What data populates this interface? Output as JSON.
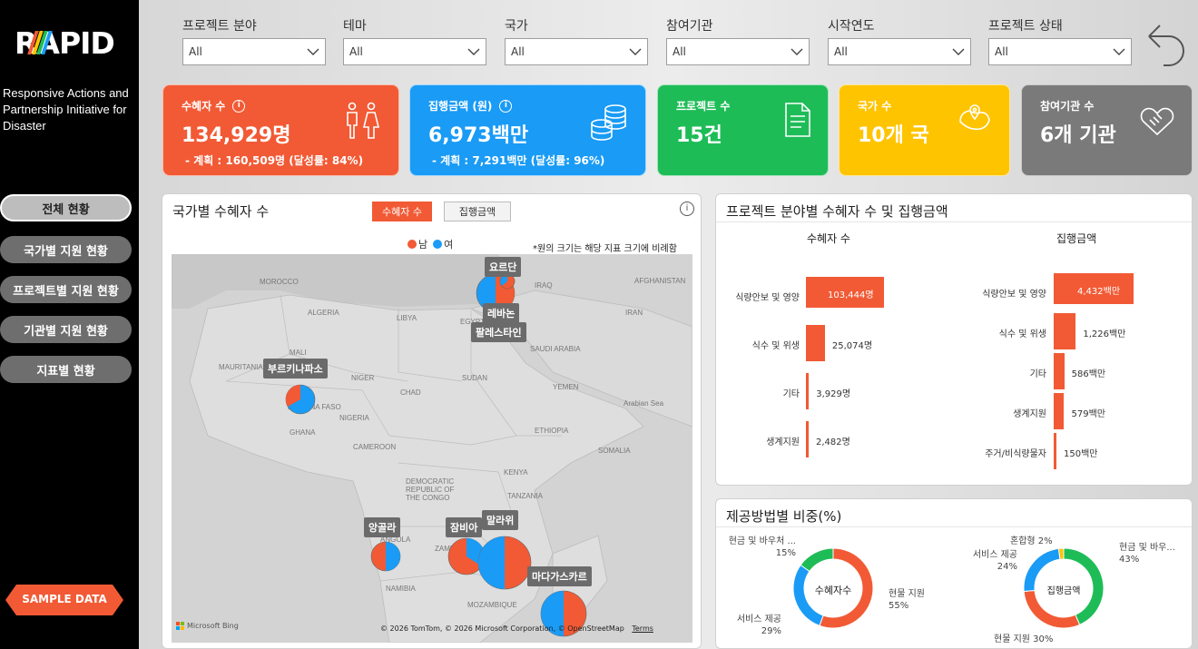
{
  "brand": {
    "logo_text": "RAPID",
    "tagline": "Responsive Actions and Partnership Initiative for Disaster",
    "sample_label": "SAMPLE DATA"
  },
  "nav": [
    {
      "label": "전체 현황",
      "active": true
    },
    {
      "label": "국가별 지원 현황",
      "active": false
    },
    {
      "label": "프로젝트별 지원 현황",
      "active": false
    },
    {
      "label": "기관별 지원 현황",
      "active": false
    },
    {
      "label": "지표별 현황",
      "active": false
    }
  ],
  "filters": [
    {
      "label": "프로젝트 분야",
      "value": "All"
    },
    {
      "label": "테마",
      "value": "All"
    },
    {
      "label": "국가",
      "value": "All"
    },
    {
      "label": "참여기관",
      "value": "All"
    },
    {
      "label": "시작연도",
      "value": "All"
    },
    {
      "label": "프로젝트 상태",
      "value": "All"
    }
  ],
  "kpis": [
    {
      "label": "수혜자 수",
      "value": "134,929명",
      "sub": "- 계획 : 160,509명 (달성률: 84%)",
      "color": "#f15a35",
      "icon": "people-icon"
    },
    {
      "label": "집행금액 (원)",
      "value": "6,973백만",
      "sub": "- 계획 : 7,291백만 (달성률: 96%)",
      "color": "#1a9bf5",
      "icon": "coins-icon"
    },
    {
      "label": "프로젝트 수",
      "value": "15건",
      "sub": "",
      "color": "#1ebc57",
      "icon": "document-icon"
    },
    {
      "label": "국가 수",
      "value": "10개 국",
      "sub": "",
      "color": "#ffc400",
      "icon": "map-pin-icon"
    },
    {
      "label": "참여기관 수",
      "value": "6개 기관",
      "sub": "",
      "color": "#7a7a7a",
      "icon": "handshake-icon"
    }
  ],
  "map_panel": {
    "title": "국가별 수혜자 수",
    "toggle_active": "수혜자 수",
    "toggle_inactive": "집행금액",
    "legend_male": "남",
    "legend_female": "여",
    "note": "*원의 크기는 해당 지표 크기에 비례함",
    "credit": "© 2026 TomTom, © 2026 Microsoft Corporation, © OpenStreetMap",
    "terms": "Terms",
    "bing": "Microsoft Bing",
    "color_male": "#f15a35",
    "color_female": "#1a9bf5",
    "map_labels": [
      "MOROCCO",
      "ALGERIA",
      "LIBYA",
      "EGYPT",
      "SAUDI ARABIA",
      "IRAQ",
      "AFGHANISTAN",
      "IRAN",
      "MAURITANIA",
      "MALI",
      "NIGER",
      "CHAD",
      "SUDAN",
      "YEMEN",
      "Arabian Sea",
      "NIGERIA",
      "GHANA",
      "CAMEROON",
      "ETHIOPIA",
      "SOMALIA",
      "KENYA",
      "DEMOCRATIC REPUBLIC OF THE CONGO",
      "TANZANIA",
      "ANGOLA",
      "ZAMBIA",
      "NAMIBIA",
      "MOZAMBIQUE",
      "BURKINA FASO"
    ],
    "countries": [
      "요르단",
      "레바논",
      "팔레스타인",
      "부르키나파소",
      "앙골라",
      "잠비아",
      "말라위",
      "마다가스카르"
    ]
  },
  "field_panel": {
    "title": "프로젝트 분야별 수혜자 수 및 집행금액",
    "left_header": "수혜자 수",
    "right_header": "집행금액",
    "left": [
      {
        "label": "식량안보 및 영양",
        "value": 103444,
        "text": "103,444명"
      },
      {
        "label": "식수 및 위생",
        "value": 25074,
        "text": "25,074명"
      },
      {
        "label": "기타",
        "value": 3929,
        "text": "3,929명"
      },
      {
        "label": "생계지원",
        "value": 2482,
        "text": "2,482명"
      }
    ],
    "right": [
      {
        "label": "식량안보 및 영양",
        "value": 4432,
        "text": "4,432백만"
      },
      {
        "label": "식수 및 위생",
        "value": 1226,
        "text": "1,226백만"
      },
      {
        "label": "기타",
        "value": 586,
        "text": "586백만"
      },
      {
        "label": "생계지원",
        "value": 579,
        "text": "579백만"
      },
      {
        "label": "주거/비식량물자",
        "value": 150,
        "text": "150백만"
      }
    ]
  },
  "method_panel": {
    "title": "제공방법별 비중(%)",
    "left_center": "수혜자수",
    "right_center": "집행금액",
    "left": [
      {
        "label": "현물 지원",
        "pct": "55%",
        "value": 55,
        "color": "#f15a35"
      },
      {
        "label": "서비스 제공",
        "pct": "29%",
        "value": 29,
        "color": "#1a9bf5"
      },
      {
        "label": "현금 및 바우처 ...",
        "pct": "15%",
        "value": 15,
        "color": "#1ebc57"
      }
    ],
    "right": [
      {
        "label": "현금 및 바우...",
        "pct": "43%",
        "value": 43,
        "color": "#1ebc57"
      },
      {
        "label": "현물 지원",
        "pct": "30%",
        "value": 30,
        "color": "#f15a35"
      },
      {
        "label": "서비스 제공",
        "pct": "24%",
        "value": 24,
        "color": "#1a9bf5"
      },
      {
        "label": "혼합형",
        "pct": "2%",
        "value": 2,
        "color": "#ffc400"
      }
    ]
  }
}
